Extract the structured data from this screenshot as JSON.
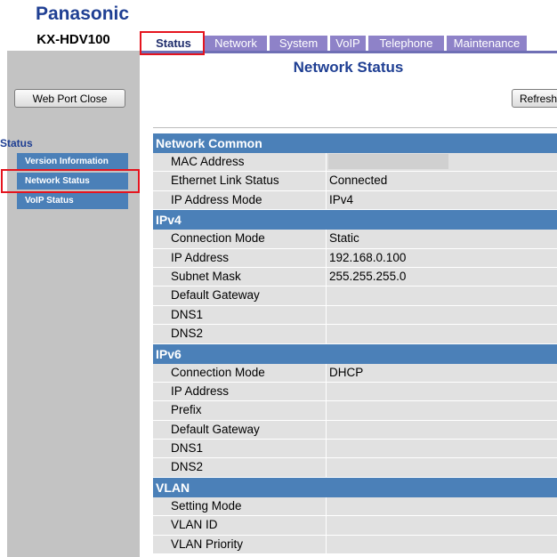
{
  "brand": {
    "logo": "Panasonic",
    "model": "KX-HDV100"
  },
  "tabs": [
    {
      "label": "Status"
    },
    {
      "label": "Network"
    },
    {
      "label": "System"
    },
    {
      "label": "VoIP"
    },
    {
      "label": "Telephone"
    },
    {
      "label": "Maintenance"
    }
  ],
  "sidebar": {
    "web_port_button": "Web Port Close",
    "heading": "Status",
    "items": [
      {
        "label": "Version Information"
      },
      {
        "label": "Network Status"
      },
      {
        "label": "VoIP Status"
      }
    ]
  },
  "main": {
    "title": "Network Status",
    "refresh_label": "Refresh",
    "sections": [
      {
        "title": "Network Common",
        "rows": [
          {
            "label": "MAC Address",
            "value": ""
          },
          {
            "label": "Ethernet Link Status",
            "value": "Connected"
          },
          {
            "label": "IP Address Mode",
            "value": "IPv4"
          }
        ]
      },
      {
        "title": "IPv4",
        "rows": [
          {
            "label": "Connection Mode",
            "value": "Static"
          },
          {
            "label": "IP Address",
            "value": "192.168.0.100"
          },
          {
            "label": "Subnet Mask",
            "value": "255.255.255.0"
          },
          {
            "label": "Default Gateway",
            "value": ""
          },
          {
            "label": "DNS1",
            "value": ""
          },
          {
            "label": "DNS2",
            "value": ""
          }
        ]
      },
      {
        "title": "IPv6",
        "rows": [
          {
            "label": "Connection Mode",
            "value": "DHCP"
          },
          {
            "label": "IP Address",
            "value": ""
          },
          {
            "label": "Prefix",
            "value": ""
          },
          {
            "label": "Default Gateway",
            "value": ""
          },
          {
            "label": "DNS1",
            "value": ""
          },
          {
            "label": "DNS2",
            "value": ""
          }
        ]
      },
      {
        "title": "VLAN",
        "rows": [
          {
            "label": "Setting Mode",
            "value": ""
          },
          {
            "label": "VLAN ID",
            "value": ""
          },
          {
            "label": "VLAN Priority",
            "value": ""
          }
        ]
      }
    ]
  },
  "colors": {
    "brand_blue": "#1f3f93",
    "section_header": "#4b80b8",
    "tab_inactive": "#8e82c8",
    "row_bg": "#e1e1e1",
    "highlight": "#e5141e"
  }
}
